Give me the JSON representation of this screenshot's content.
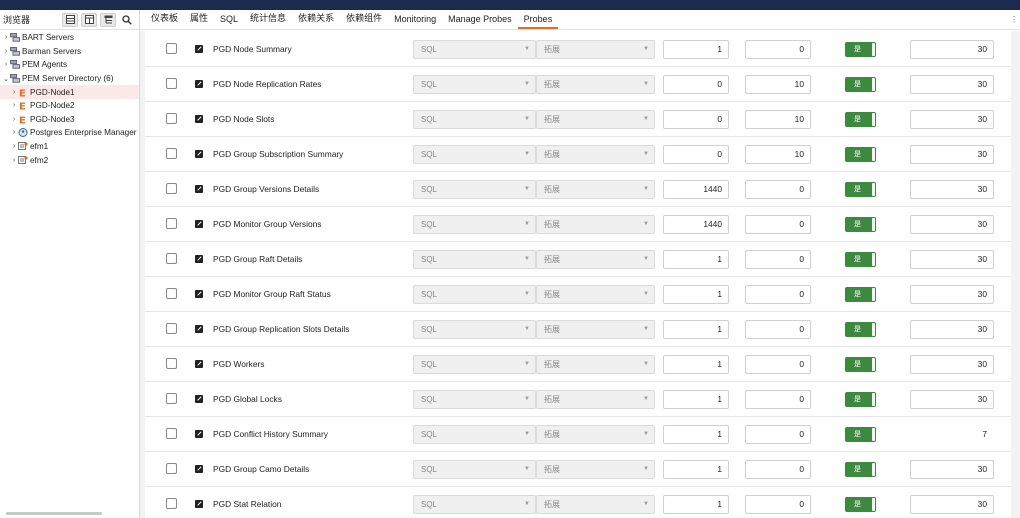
{
  "browser": {
    "title": "浏览器",
    "tools": [
      "db-grid-icon",
      "table-icon",
      "tree-icon",
      "search-icon"
    ],
    "tree": [
      {
        "label": "BART Servers",
        "icon": "server-group-icon",
        "expanded": false,
        "depth": 0,
        "selected": false
      },
      {
        "label": "Barman Servers",
        "icon": "server-group-icon",
        "expanded": false,
        "depth": 0,
        "selected": false
      },
      {
        "label": "PEM Agents",
        "icon": "server-group-icon",
        "expanded": false,
        "depth": 0,
        "selected": false
      },
      {
        "label": "PEM Server Directory (6)",
        "icon": "server-group-icon",
        "expanded": true,
        "depth": 0,
        "selected": false
      },
      {
        "label": "PGD-Node1",
        "icon": "pgd-node-icon",
        "expanded": false,
        "depth": 1,
        "selected": true
      },
      {
        "label": "PGD-Node2",
        "icon": "pgd-node-icon",
        "expanded": false,
        "depth": 1,
        "selected": false
      },
      {
        "label": "PGD-Node3",
        "icon": "pgd-node-icon",
        "expanded": false,
        "depth": 1,
        "selected": false
      },
      {
        "label": "Postgres Enterprise Manager",
        "icon": "postgres-elephant-icon",
        "expanded": false,
        "depth": 1,
        "selected": false
      },
      {
        "label": "efm1",
        "icon": "efm-cluster-icon",
        "expanded": false,
        "depth": 1,
        "selected": false
      },
      {
        "label": "efm2",
        "icon": "efm-cluster-icon",
        "expanded": false,
        "depth": 1,
        "selected": false
      }
    ]
  },
  "tabs": [
    {
      "label": "仪表板",
      "active": false
    },
    {
      "label": "属性",
      "active": false
    },
    {
      "label": "SQL",
      "active": false
    },
    {
      "label": "统计信息",
      "active": false
    },
    {
      "label": "依赖关系",
      "active": false
    },
    {
      "label": "依赖组件",
      "active": false
    },
    {
      "label": "Monitoring",
      "active": false
    },
    {
      "label": "Manage Probes",
      "active": false
    },
    {
      "label": "Probes",
      "active": true
    }
  ],
  "colors": {
    "accent_tab": "#e06c29",
    "toggle_on": "#3c8a3e",
    "selected_row": "#fbe9e9",
    "top_bar": "#1b2a4e"
  },
  "probes": [
    {
      "name": "PGD Node Summary",
      "collection": "SQL",
      "target": "拓展",
      "interval": "1",
      "minutes": "0",
      "enabled": "是",
      "retention": "30",
      "retention_boxed": true
    },
    {
      "name": "PGD Node Replication Rates",
      "collection": "SQL",
      "target": "拓展",
      "interval": "0",
      "minutes": "10",
      "enabled": "是",
      "retention": "30",
      "retention_boxed": true
    },
    {
      "name": "PGD Node Slots",
      "collection": "SQL",
      "target": "拓展",
      "interval": "0",
      "minutes": "10",
      "enabled": "是",
      "retention": "30",
      "retention_boxed": true
    },
    {
      "name": "PGD Group Subscription Summary",
      "collection": "SQL",
      "target": "拓展",
      "interval": "0",
      "minutes": "10",
      "enabled": "是",
      "retention": "30",
      "retention_boxed": true
    },
    {
      "name": "PGD Group Versions Details",
      "collection": "SQL",
      "target": "拓展",
      "interval": "1440",
      "minutes": "0",
      "enabled": "是",
      "retention": "30",
      "retention_boxed": true
    },
    {
      "name": "PGD Monitor Group Versions",
      "collection": "SQL",
      "target": "拓展",
      "interval": "1440",
      "minutes": "0",
      "enabled": "是",
      "retention": "30",
      "retention_boxed": true
    },
    {
      "name": "PGD Group Raft Details",
      "collection": "SQL",
      "target": "拓展",
      "interval": "1",
      "minutes": "0",
      "enabled": "是",
      "retention": "30",
      "retention_boxed": true
    },
    {
      "name": "PGD Monitor Group Raft Status",
      "collection": "SQL",
      "target": "拓展",
      "interval": "1",
      "minutes": "0",
      "enabled": "是",
      "retention": "30",
      "retention_boxed": true
    },
    {
      "name": "PGD Group Replication Slots Details",
      "collection": "SQL",
      "target": "拓展",
      "interval": "1",
      "minutes": "0",
      "enabled": "是",
      "retention": "30",
      "retention_boxed": true
    },
    {
      "name": "PGD Workers",
      "collection": "SQL",
      "target": "拓展",
      "interval": "1",
      "minutes": "0",
      "enabled": "是",
      "retention": "30",
      "retention_boxed": true
    },
    {
      "name": "PGD Global Locks",
      "collection": "SQL",
      "target": "拓展",
      "interval": "1",
      "minutes": "0",
      "enabled": "是",
      "retention": "30",
      "retention_boxed": true
    },
    {
      "name": "PGD Conflict History Summary",
      "collection": "SQL",
      "target": "拓展",
      "interval": "1",
      "minutes": "0",
      "enabled": "是",
      "retention": "7",
      "retention_boxed": false
    },
    {
      "name": "PGD Group Camo Details",
      "collection": "SQL",
      "target": "拓展",
      "interval": "1",
      "minutes": "0",
      "enabled": "是",
      "retention": "30",
      "retention_boxed": true
    },
    {
      "name": "PGD Stat Relation",
      "collection": "SQL",
      "target": "拓展",
      "interval": "1",
      "minutes": "0",
      "enabled": "是",
      "retention": "30",
      "retention_boxed": true
    }
  ]
}
